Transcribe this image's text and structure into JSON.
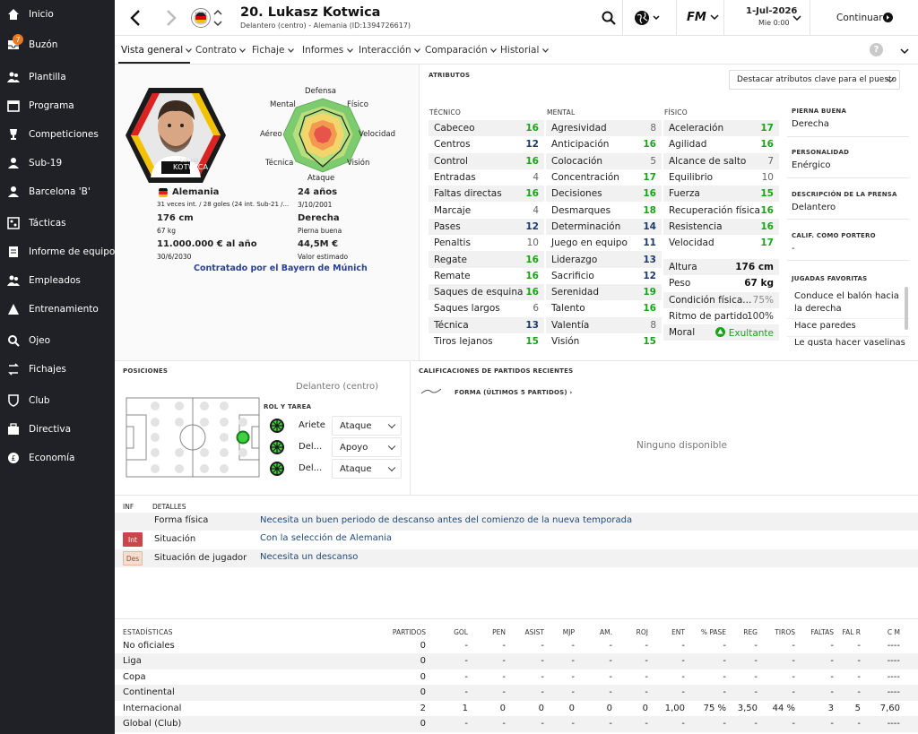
{
  "sidebar": {
    "items": [
      {
        "label": "Inicio",
        "icon": "home-icon"
      },
      {
        "label": "Buzón",
        "icon": "inbox-icon",
        "badge": "7"
      },
      {
        "label": "Plantilla",
        "icon": "squad-icon"
      },
      {
        "label": "Programa",
        "icon": "calendar-icon"
      },
      {
        "label": "Competiciones",
        "icon": "trophy-icon"
      },
      {
        "label": "Sub-19",
        "icon": "youth-icon"
      },
      {
        "label": "Barcelona 'B'",
        "icon": "reserve-icon"
      },
      {
        "label": "Tácticas",
        "icon": "tactics-icon"
      },
      {
        "label": "Informe de equipo",
        "icon": "report-icon"
      },
      {
        "label": "Empleados",
        "icon": "staff-icon"
      },
      {
        "label": "Entrenamiento",
        "icon": "training-icon"
      },
      {
        "label": "Ojeo",
        "icon": "scouting-icon"
      },
      {
        "label": "Fichajes",
        "icon": "transfers-icon"
      },
      {
        "label": "Club",
        "icon": "club-icon"
      },
      {
        "label": "Directiva",
        "icon": "board-icon"
      },
      {
        "label": "Economía",
        "icon": "finances-icon"
      }
    ]
  },
  "header": {
    "player_name": "20. Lukasz Kotwica",
    "player_sub": "Delantero (centro) - Alemania (ID:1394726617)",
    "date": "1-Jul-2026",
    "time": "Mie 0:00",
    "continue_label": "Continuar",
    "fm_logo": "FM"
  },
  "tabs": [
    "Vista general",
    "Contrato",
    "Fichaje",
    "Informes",
    "Interacción",
    "Comparación",
    "Historial"
  ],
  "profile": {
    "portrait_name_small": "Lukasz",
    "portrait_name": "KOTWICA",
    "nation": "Alemania",
    "caps": "31 veces int. / 28 goles (24 int. Sub-21 /...",
    "height": "176 cm",
    "weight": "67 kg",
    "wage": "11.000.000 € al año",
    "contract_end": "30/6/2030",
    "age": "24 años",
    "dob": "3/10/2001",
    "foot": "Derecha",
    "foot_label": "Pierna buena",
    "value": "44,5M €",
    "value_label": "Valor estimado",
    "signed_by": "Contratado por el Bayern de Múnich",
    "radar_labels": {
      "top": "Defensa",
      "tl": "Mental",
      "tr": "Físico",
      "l": "Aéreo",
      "r": "Velocidad",
      "bl": "Técnica",
      "br": "Visión",
      "bottom": "Ataque"
    }
  },
  "attributes": {
    "title": "ATRIBUTOS",
    "highlight_dropdown": "Destacar atributos clave para el puesto",
    "tech_title": "TÉCNICO",
    "mental_title": "MENTAL",
    "phys_title": "FÍSICO",
    "technical": [
      {
        "name": "Cabeceo",
        "value": "16"
      },
      {
        "name": "Centros",
        "value": "12"
      },
      {
        "name": "Control",
        "value": "16"
      },
      {
        "name": "Entradas",
        "value": "4"
      },
      {
        "name": "Faltas directas",
        "value": "16"
      },
      {
        "name": "Marcaje",
        "value": "4"
      },
      {
        "name": "Pases",
        "value": "12"
      },
      {
        "name": "Penaltis",
        "value": "10"
      },
      {
        "name": "Regate",
        "value": "16"
      },
      {
        "name": "Remate",
        "value": "16"
      },
      {
        "name": "Saques de esquina",
        "value": "16"
      },
      {
        "name": "Saques largos",
        "value": "6"
      },
      {
        "name": "Técnica",
        "value": "13"
      },
      {
        "name": "Tiros lejanos",
        "value": "15"
      }
    ],
    "mental": [
      {
        "name": "Agresividad",
        "value": "8"
      },
      {
        "name": "Anticipación",
        "value": "16"
      },
      {
        "name": "Colocación",
        "value": "5"
      },
      {
        "name": "Concentración",
        "value": "17"
      },
      {
        "name": "Decisiones",
        "value": "16"
      },
      {
        "name": "Desmarques",
        "value": "18"
      },
      {
        "name": "Determinación",
        "value": "14"
      },
      {
        "name": "Juego en equipo",
        "value": "11"
      },
      {
        "name": "Liderazgo",
        "value": "13"
      },
      {
        "name": "Sacrificio",
        "value": "12"
      },
      {
        "name": "Serenidad",
        "value": "19"
      },
      {
        "name": "Talento",
        "value": "16"
      },
      {
        "name": "Valentía",
        "value": "8"
      },
      {
        "name": "Visión",
        "value": "15"
      }
    ],
    "physical": [
      {
        "name": "Aceleración",
        "value": "17"
      },
      {
        "name": "Agilidad",
        "value": "16"
      },
      {
        "name": "Alcance de salto",
        "value": "7"
      },
      {
        "name": "Equilibrio",
        "value": "10"
      },
      {
        "name": "Fuerza",
        "value": "15"
      },
      {
        "name": "Recuperación física",
        "value": "16"
      },
      {
        "name": "Resistencia",
        "value": "16"
      },
      {
        "name": "Velocidad",
        "value": "17"
      }
    ],
    "extra": [
      {
        "name": "Altura",
        "value": "176 cm"
      },
      {
        "name": "Peso",
        "value": "67 kg"
      },
      {
        "name": "Condición física...",
        "value": "75%"
      },
      {
        "name": "Ritmo de partido",
        "value": "100%"
      },
      {
        "name": "Moral",
        "value": "Exultante"
      }
    ]
  },
  "side_info": {
    "foot_title": "PIERNA BUENA",
    "foot_value": "Derecha",
    "personality_title": "PERSONALIDAD",
    "personality_value": "Enérgico",
    "press_title": "DESCRIPCIÓN DE LA PRENSA",
    "press_value": "Delantero",
    "gk_title": "CALIF. COMO PORTERO",
    "gk_value": "-",
    "fav_title": "JUGADAS FAVORITAS",
    "fav_items": [
      "Conduce el balón hacia la derecha",
      "Hace paredes",
      "Le gusta hacer vaselinas"
    ]
  },
  "positions": {
    "title": "POSICIONES",
    "main_position": "Delantero (centro)",
    "role_title": "ROL Y TAREA",
    "roles": [
      {
        "role": "Ariete",
        "duty": "Ataque"
      },
      {
        "role": "Del...",
        "duty": "Apoyo"
      },
      {
        "role": "Del...",
        "duty": "Ataque"
      }
    ]
  },
  "recent": {
    "title": "CALIFICACIONES DE PARTIDOS RECIENTES",
    "form_label": "FORMA (ÚLTIMOS 5 PARTIDOS)",
    "empty": "Ninguno disponible"
  },
  "info": {
    "col1": "INF",
    "col2": "DETALLES",
    "rows": [
      {
        "tag": "",
        "label": "Forma física",
        "detail": "Necesita un buen periodo de descanso antes del comienzo de la nueva temporada"
      },
      {
        "tag": "Int",
        "label": "Situación",
        "detail": "Con la selección de Alemania"
      },
      {
        "tag": "Des",
        "label": "Situación de jugador",
        "detail": "Necesita un descanso"
      }
    ]
  },
  "stats": {
    "title": "ESTADÍSTICAS",
    "columns": [
      "PARTIDOS",
      "GOL",
      "PEN",
      "ASIST",
      "MJP",
      "AM.",
      "ROJ",
      "ENT",
      "% PASE",
      "REG",
      "TIROS",
      "FALTAS",
      "FAL R",
      "C M"
    ],
    "rows": [
      {
        "name": "No oficiales",
        "values": [
          "0",
          "-",
          "-",
          "-",
          "-",
          "-",
          "-",
          "-",
          "-",
          "-",
          "-",
          "-",
          "-",
          "----"
        ]
      },
      {
        "name": "Liga",
        "values": [
          "0",
          "-",
          "-",
          "-",
          "-",
          "-",
          "-",
          "-",
          "-",
          "-",
          "-",
          "-",
          "-",
          "----"
        ]
      },
      {
        "name": "Copa",
        "values": [
          "0",
          "-",
          "-",
          "-",
          "-",
          "-",
          "-",
          "-",
          "-",
          "-",
          "-",
          "-",
          "-",
          "----"
        ]
      },
      {
        "name": "Continental",
        "values": [
          "0",
          "-",
          "-",
          "-",
          "-",
          "-",
          "-",
          "-",
          "-",
          "-",
          "-",
          "-",
          "-",
          "----"
        ]
      },
      {
        "name": "Internacional",
        "values": [
          "2",
          "1",
          "0",
          "0",
          "0",
          "0",
          "0",
          "1,00",
          "75 %",
          "3,50",
          "44 %",
          "3",
          "5",
          "7,60"
        ]
      },
      {
        "name": "Global (Club)",
        "values": [
          "0",
          "-",
          "-",
          "-",
          "-",
          "-",
          "-",
          "-",
          "-",
          "-",
          "-",
          "-",
          "-",
          "----"
        ]
      }
    ]
  },
  "colors": {
    "sidebar_bg": "#1f2127",
    "accent_green": "#1aa31a",
    "link_blue": "#2a3f9a",
    "badge_orange": "#e87a1e"
  }
}
